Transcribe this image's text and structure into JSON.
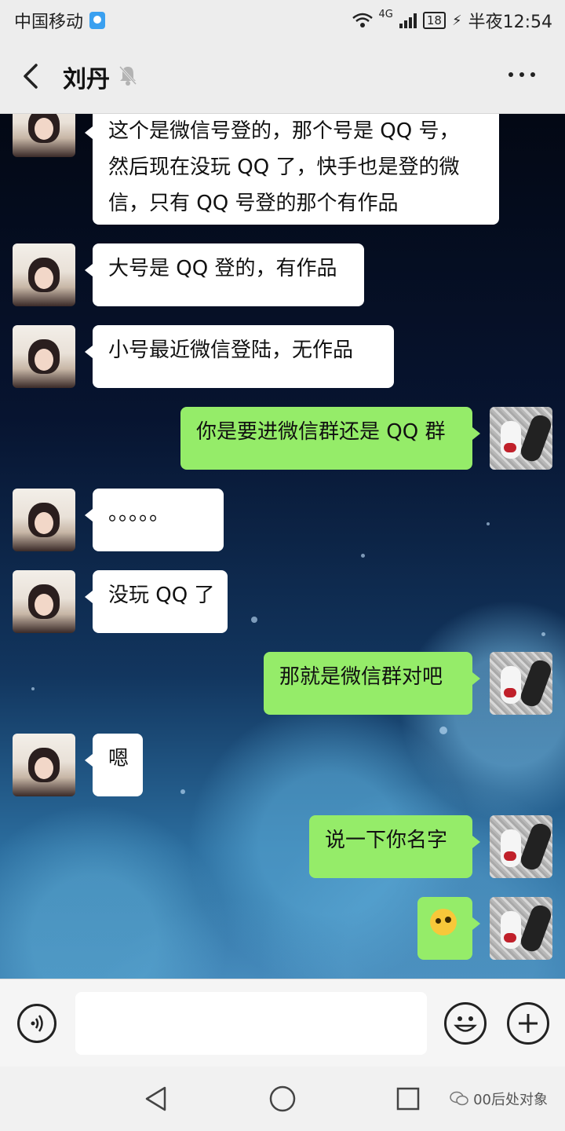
{
  "status_bar": {
    "carrier": "中国移动",
    "network": "4G",
    "battery": "18",
    "time": "半夜12:54"
  },
  "header": {
    "contact_name": "刘丹"
  },
  "messages": [
    {
      "sender": "her",
      "text_lines": [
        "这个是微信号登的，那个号是 QQ 号，",
        "然后现在没玩 QQ 了，快手也是登的微",
        "信，只有 QQ 号登的那个有作品"
      ]
    },
    {
      "sender": "her",
      "text": "大号是 QQ 登的，有作品"
    },
    {
      "sender": "her",
      "text": "小号最近微信登陆，无作品"
    },
    {
      "sender": "me",
      "text": "你是要进微信群还是 QQ 群"
    },
    {
      "sender": "her",
      "text": "。。。。。"
    },
    {
      "sender": "her",
      "text": "没玩 QQ 了"
    },
    {
      "sender": "me",
      "text": "那就是微信群对吧"
    },
    {
      "sender": "her",
      "text": "嗯"
    },
    {
      "sender": "me",
      "text": "说一下你名字"
    },
    {
      "sender": "me",
      "emoji": "thinking-face-emoji"
    }
  ],
  "input_bar": {
    "text_value": "",
    "voice_icon": "voice-icon",
    "emoji_icon": "smiley-icon",
    "plus_icon": "plus-icon"
  },
  "watermark": "00后处对象",
  "colors": {
    "my_bubble": "#95ec69",
    "her_bubble": "#ffffff",
    "bar_background": "#ededed"
  }
}
